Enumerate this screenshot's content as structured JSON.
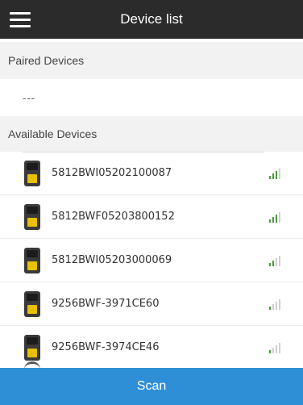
{
  "header": {
    "title": "Device list",
    "menu_icon": "hamburger-menu-icon"
  },
  "paired": {
    "heading": "Paired Devices",
    "empty_text": "---"
  },
  "available": {
    "heading": "Available Devices",
    "devices": [
      {
        "name": "5812BWI05202100087",
        "signal_level": 3,
        "signal_max": 4
      },
      {
        "name": "5812BWF05203800152",
        "signal_level": 3,
        "signal_max": 4
      },
      {
        "name": "5812BWI05203000069",
        "signal_level": 2,
        "signal_max": 4
      },
      {
        "name": "9256BWF-3971CE60",
        "signal_level": 1,
        "signal_max": 4
      },
      {
        "name": "9256BWF-3974CE46",
        "signal_level": 1,
        "signal_max": 4
      }
    ]
  },
  "footer": {
    "scan_label": "Scan"
  },
  "colors": {
    "header_bg": "#2b2b2b",
    "scan_bg": "#2f8fd6",
    "signal_on": "#4a9a3a",
    "signal_off": "#cfcfcf",
    "device_badge": "#e8c100"
  }
}
